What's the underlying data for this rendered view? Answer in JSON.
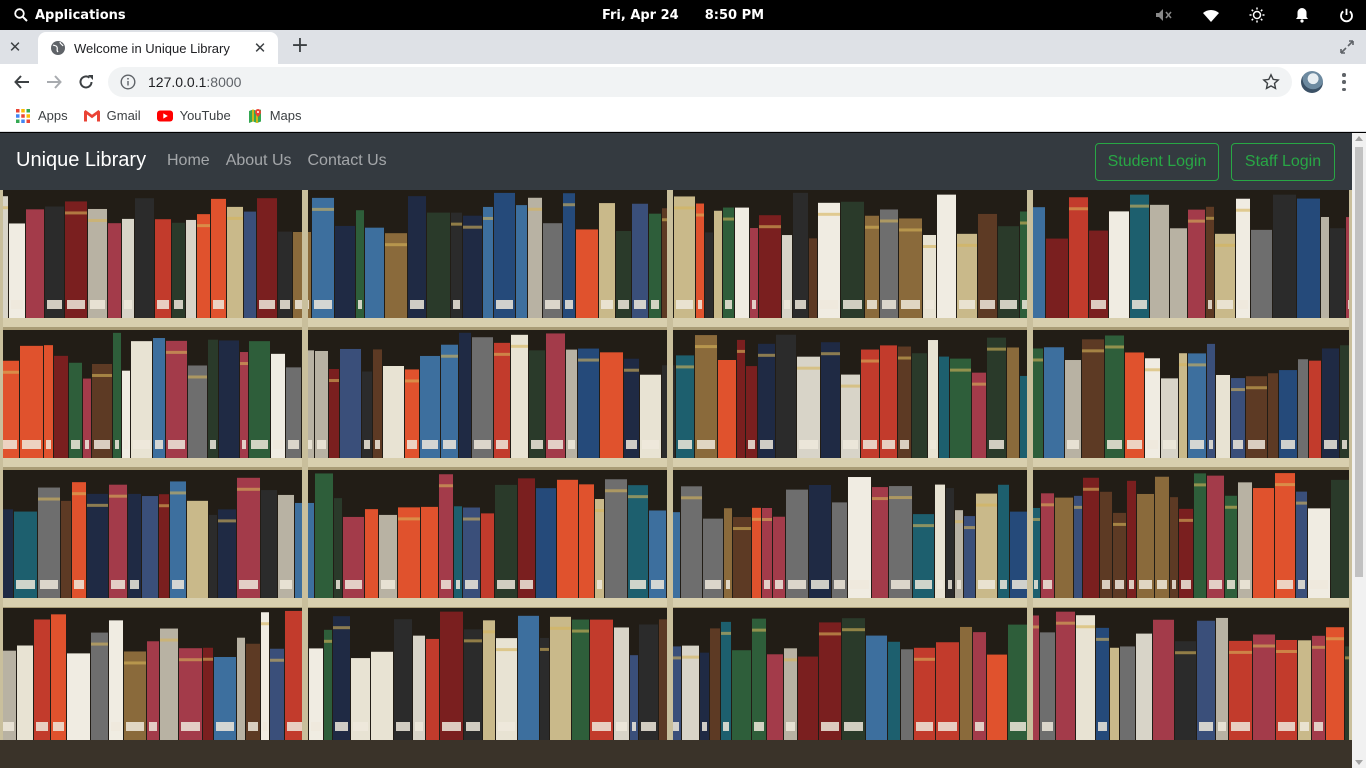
{
  "system_bar": {
    "applications_label": "Applications",
    "date": "Fri, Apr 24",
    "time": "8:50 PM",
    "icons": [
      "search-icon",
      "volume-muted-icon",
      "wifi-icon",
      "brightness-icon",
      "notification-bell-icon",
      "power-icon"
    ]
  },
  "browser": {
    "tab_title": "Welcome in Unique Library",
    "url_host": "127.0.0.1",
    "url_port": ":8000",
    "bookmarks": [
      {
        "label": "Apps",
        "icon": "apps-grid-icon"
      },
      {
        "label": "Gmail",
        "icon": "gmail-icon"
      },
      {
        "label": "YouTube",
        "icon": "youtube-icon"
      },
      {
        "label": "Maps",
        "icon": "maps-icon"
      }
    ]
  },
  "page": {
    "brand": "Unique Library",
    "nav": [
      "Home",
      "About Us",
      "Contact Us"
    ],
    "student_login": "Student Login",
    "staff_login": "Staff Login",
    "hero_image": "library-bookshelves-photo"
  },
  "colors": {
    "navbar_bg": "#343a40",
    "login_button": "#28a745",
    "tab_strip": "#dee1e6"
  }
}
